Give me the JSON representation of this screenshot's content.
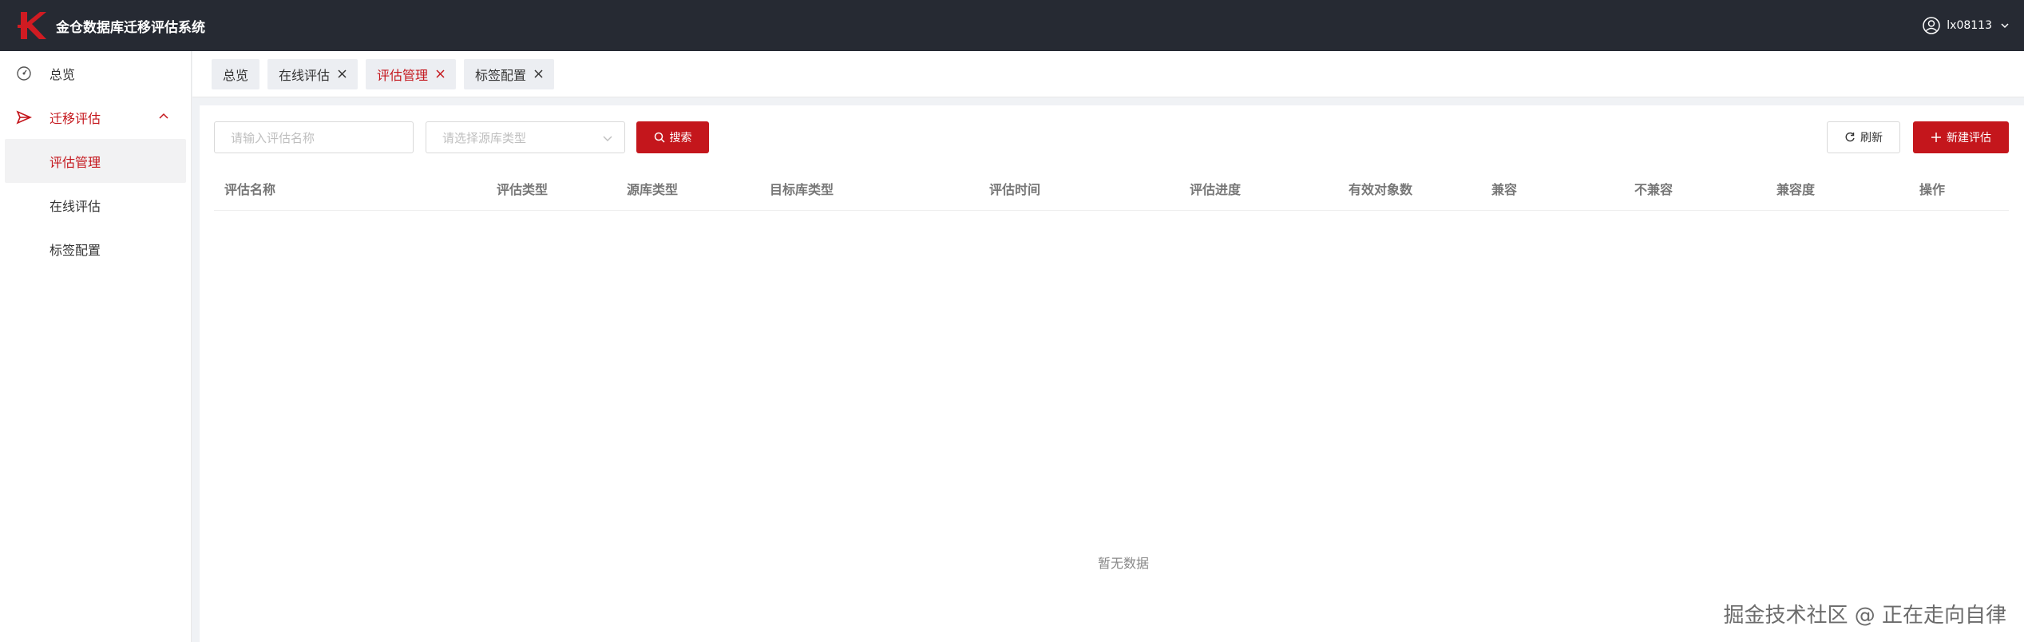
{
  "app": {
    "title": "金仓数据库迁移评估系统",
    "username": "lx08113"
  },
  "sidebar": {
    "items": [
      {
        "label": "总览",
        "icon": "dashboard-icon"
      },
      {
        "label": "迁移评估",
        "icon": "send-icon",
        "expanded": true,
        "children": [
          {
            "label": "评估管理",
            "selected": true
          },
          {
            "label": "在线评估"
          },
          {
            "label": "标签配置"
          }
        ]
      }
    ]
  },
  "tabs": [
    {
      "label": "总览",
      "closable": false
    },
    {
      "label": "在线评估",
      "closable": true
    },
    {
      "label": "评估管理",
      "closable": true,
      "active": true
    },
    {
      "label": "标签配置",
      "closable": true
    }
  ],
  "filters": {
    "name_placeholder": "请输入评估名称",
    "source_type_placeholder": "请选择源库类型",
    "search_label": "搜索",
    "refresh_label": "刷新",
    "new_label": "新建评估"
  },
  "table": {
    "columns": [
      "评估名称",
      "评估类型",
      "源库类型",
      "目标库类型",
      "评估时间",
      "评估进度",
      "有效对象数",
      "兼容",
      "不兼容",
      "兼容度",
      "操作"
    ],
    "rows": [],
    "empty_text": "暂无数据"
  },
  "watermark": "掘金技术社区 @ 正在走向自律",
  "colors": {
    "accent": "#c4161c",
    "header_bg": "#262a33"
  }
}
